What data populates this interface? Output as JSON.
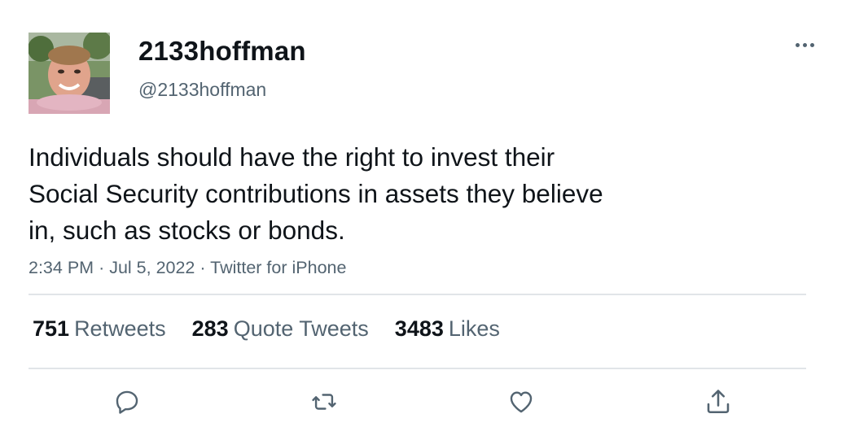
{
  "user": {
    "display_name": "2133hoffman",
    "handle": "@2133hoffman"
  },
  "tweet": {
    "text_lines": [
      "Individuals should have the right to invest their",
      "Social Security contributions in assets they believe",
      "in, such as stocks or bonds."
    ],
    "time": "2:34 PM",
    "date": "Jul 5, 2022",
    "source": "Twitter for iPhone",
    "separator": "·"
  },
  "stats": {
    "retweets": {
      "count": "751",
      "label": "Retweets"
    },
    "quotes": {
      "count": "283",
      "label": "Quote Tweets"
    },
    "likes": {
      "count": "3483",
      "label": "Likes"
    }
  },
  "icons": {
    "more": "more-horizontal-icon",
    "reply": "reply-icon",
    "retweet": "retweet-icon",
    "like": "heart-icon",
    "share": "share-icon"
  },
  "colors": {
    "text_primary": "#0f1419",
    "text_secondary": "#536471",
    "divider": "#e1e5e8"
  }
}
